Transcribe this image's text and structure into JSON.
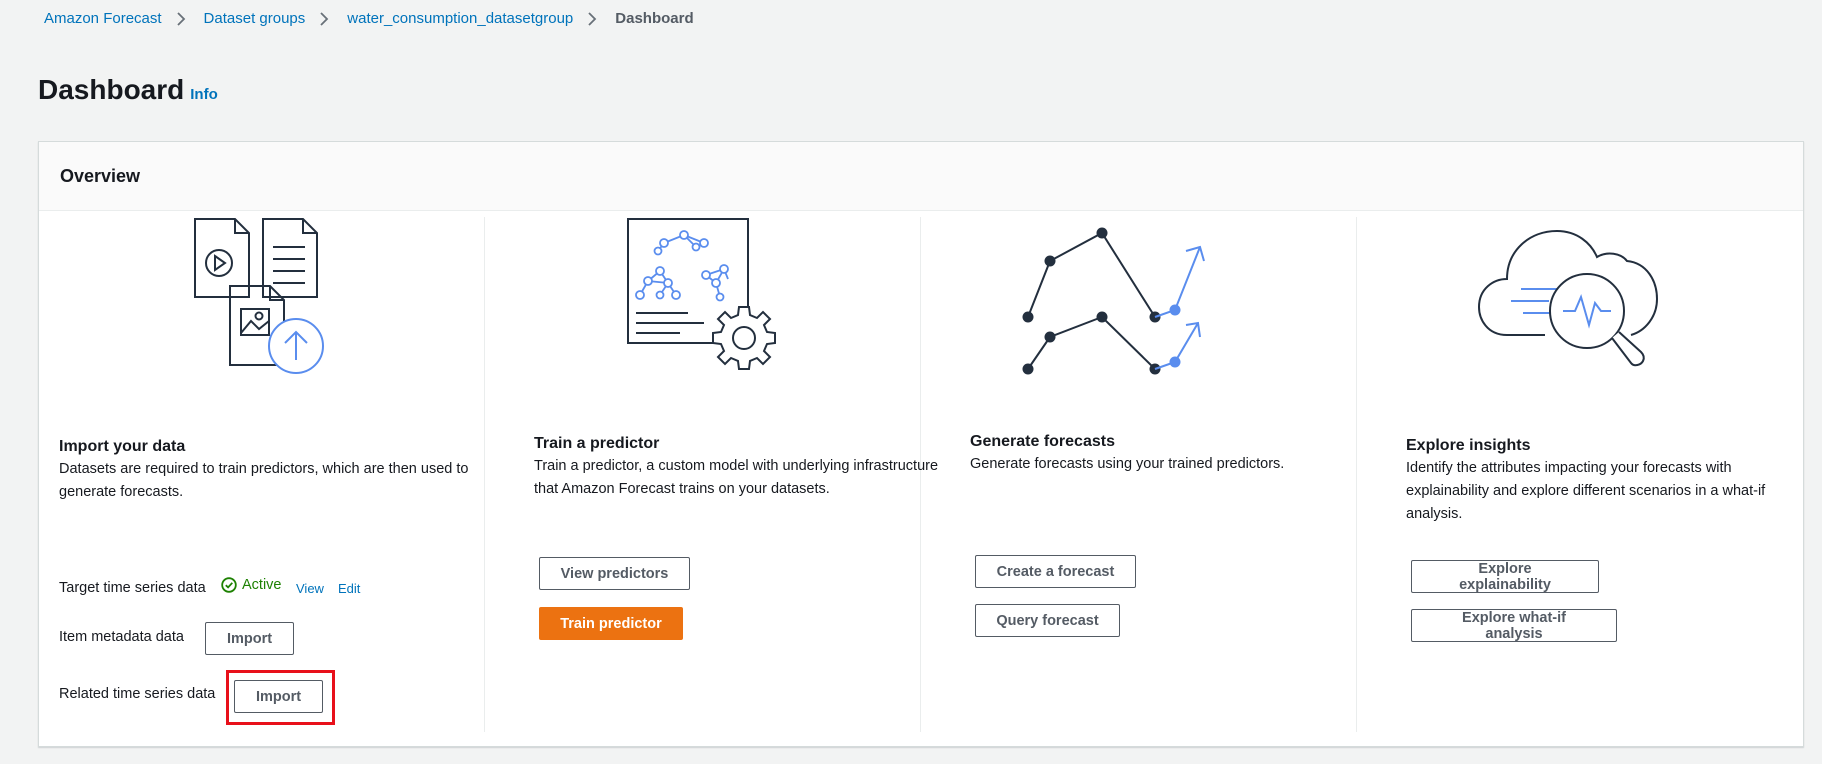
{
  "breadcrumb": {
    "items": [
      "Amazon Forecast",
      "Dataset groups",
      "water_consumption_datasetgroup"
    ],
    "current": "Dashboard"
  },
  "page": {
    "title": "Dashboard",
    "info_link": "Info"
  },
  "overview": {
    "title": "Overview",
    "import": {
      "title": "Import your data",
      "description": "Datasets are required to train predictors, which are then used to generate forecasts.",
      "target": {
        "label": "Target time series data",
        "status": "Active",
        "view": "View",
        "edit": "Edit"
      },
      "item_metadata": {
        "label": "Item metadata data",
        "button": "Import"
      },
      "related": {
        "label": "Related time series data",
        "button": "Import"
      }
    },
    "train": {
      "title": "Train a predictor",
      "description": "Train a predictor, a custom model with underlying infrastructure that Amazon Forecast trains on your datasets.",
      "view_button": "View predictors",
      "train_button": "Train predictor"
    },
    "forecast": {
      "title": "Generate forecasts",
      "description": "Generate forecasts using your trained predictors.",
      "create_button": "Create a forecast",
      "query_button": "Query forecast"
    },
    "insights": {
      "title": "Explore insights",
      "description": "Identify the attributes impacting your forecasts with explainability and explore different scenarios in a what-if analysis.",
      "explainability_button": "Explore explainability",
      "whatif_button": "Explore what-if analysis"
    }
  },
  "colors": {
    "link": "#0073bb",
    "primary": "#ec7211",
    "success": "#1d8102",
    "highlight": "#e8101a",
    "accent_blue": "#5a8dee"
  },
  "icons": [
    "chevron-right-icon",
    "status-active-icon",
    "import-data-illustration",
    "train-predictor-illustration",
    "generate-forecast-illustration",
    "explore-insights-illustration"
  ]
}
